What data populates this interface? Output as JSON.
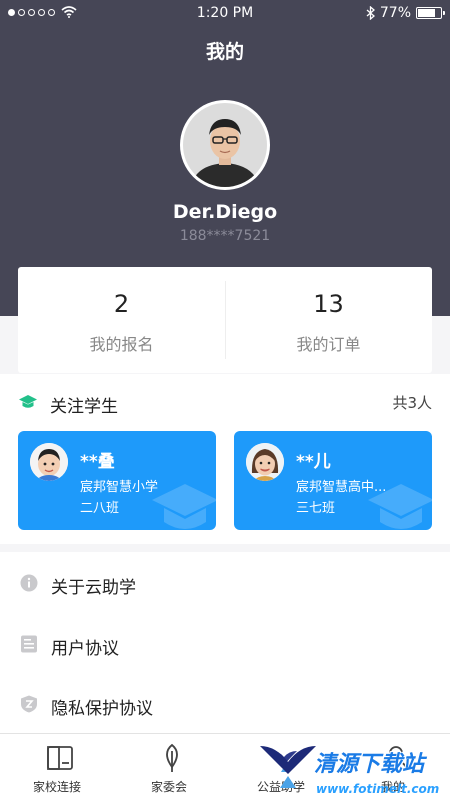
{
  "status_bar": {
    "time": "1:20 PM",
    "battery": "77%",
    "battery_level": 0.77
  },
  "page": {
    "title": "我的"
  },
  "profile": {
    "name": "Der.Diego",
    "phone": "188****7521"
  },
  "stats": [
    {
      "value": "2",
      "label": "我的报名"
    },
    {
      "value": "13",
      "label": "我的订单"
    }
  ],
  "students": {
    "title": "关注学生",
    "count": "共3人",
    "cards": [
      {
        "name": "**叠",
        "school": "宸邦智慧小学",
        "class": "二八班"
      },
      {
        "name": "**儿",
        "school": "宸邦智慧高中...",
        "class": "三七班"
      }
    ]
  },
  "menu": [
    {
      "label": "关于云助学",
      "icon": "info-icon"
    },
    {
      "label": "用户协议",
      "icon": "document-icon"
    },
    {
      "label": "隐私保护协议",
      "icon": "shield-icon"
    }
  ],
  "tabs": [
    {
      "label": "家校连接",
      "icon": "document-icon"
    },
    {
      "label": "家委会",
      "icon": "leaf-icon"
    },
    {
      "label": "公益助学",
      "icon": "wings-icon"
    },
    {
      "label": "我的",
      "icon": "user-icon"
    }
  ],
  "watermark": {
    "text": "清源下载站",
    "url": "www.fotimelt.com"
  },
  "colors": {
    "header_bg": "#464656",
    "card_blue": "#1e9afa",
    "accent_green": "#22c08a"
  }
}
